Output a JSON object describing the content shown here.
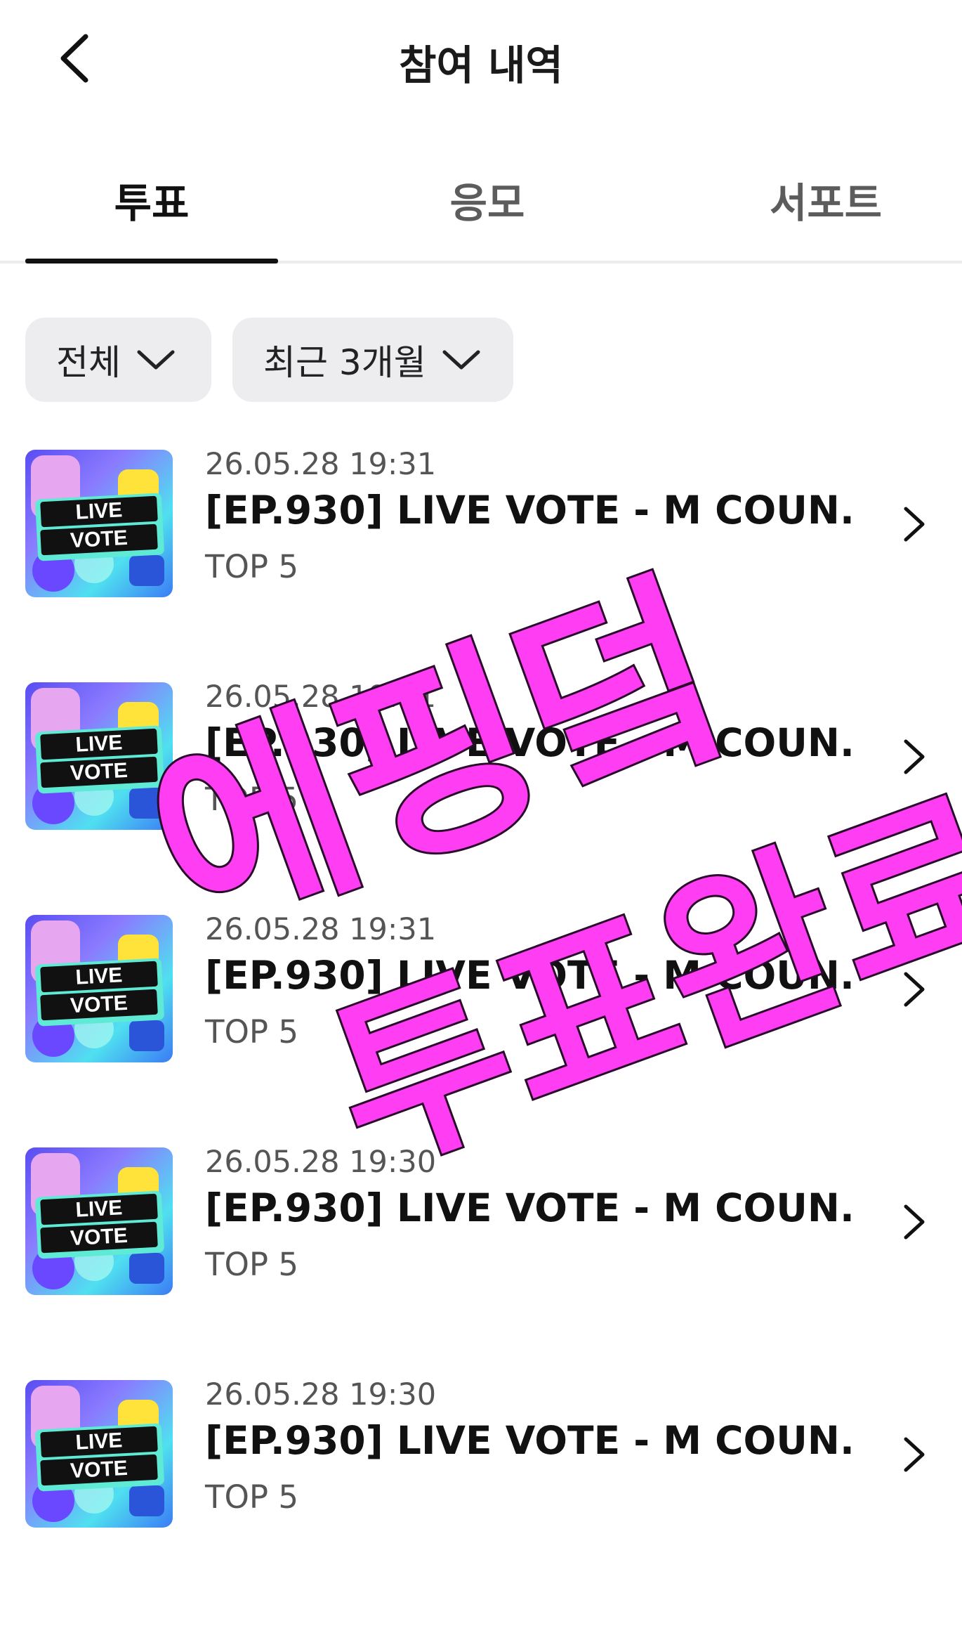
{
  "header": {
    "title": "참여 내역"
  },
  "tabs": [
    {
      "label": "투표",
      "active": true
    },
    {
      "label": "응모",
      "active": false
    },
    {
      "label": "서포트",
      "active": false
    }
  ],
  "filters": [
    {
      "label": "전체"
    },
    {
      "label": "최근 3개월"
    }
  ],
  "thumbnail": {
    "line1": "LIVE",
    "line2": "VOTE"
  },
  "items": [
    {
      "date": "26.05.28 19:31",
      "title": "[EP.930] LIVE VOTE - M COUN...",
      "subtitle": "TOP 5"
    },
    {
      "date": "26.05.28 19:31",
      "title": "[EP.930] LIVE VOTE - M COUN...",
      "subtitle": "TOP 5"
    },
    {
      "date": "26.05.28 19:31",
      "title": "[EP.930] LIVE VOTE - M COUN...",
      "subtitle": "TOP 5"
    },
    {
      "date": "26.05.28 19:30",
      "title": "[EP.930] LIVE VOTE - M COUN...",
      "subtitle": "TOP 5"
    },
    {
      "date": "26.05.28 19:30",
      "title": "[EP.930] LIVE VOTE - M COUN...",
      "subtitle": "TOP 5"
    }
  ],
  "overlay": {
    "line1": "에핑덬",
    "line2": "투표완료",
    "color": "#ff3df2"
  },
  "colors": {
    "chip_bg": "#ededf0",
    "active_tab": "#111111"
  }
}
